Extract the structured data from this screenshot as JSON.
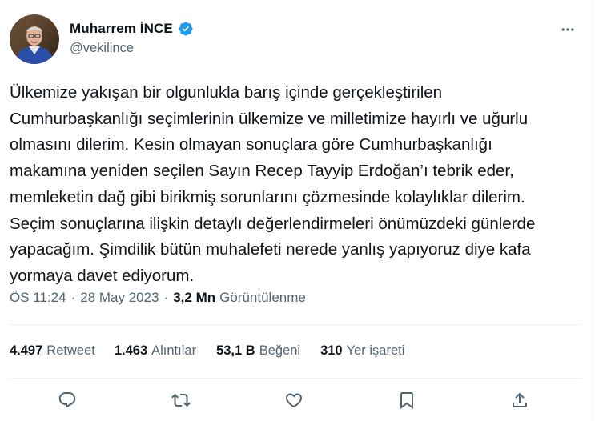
{
  "author": {
    "name": "Muharrem İNCE",
    "handle": "@vekilince",
    "verified": true
  },
  "tweet": {
    "lines": [
      "Ülkemize yakışan bir olgunlukla barış içinde gerçekleştirilen",
      "Cumhurbaşkanlığı seçimlerinin ülkemize ve milletimize hayırlı ve uğurlu",
      "olmasını dilerim. Kesin olmayan sonuçlara göre Cumhurbaşkanlığı",
      "makamına yeniden seçilen Sayın Recep Tayyip Erdoğan’ı tebrik eder,",
      "memleketin dağ gibi birikmiş sorunlarını çözmesinde kolaylıklar dilerim.",
      "Seçim sonuçlarına ilişkin detaylı değerlendirmeleri önümüzdeki günlerde",
      "yapacağım. Şimdilik bütün muhalefeti nerede yanlış yapıyoruz diye kafa",
      "yormaya davet ediyorum."
    ]
  },
  "meta": {
    "time": "ÖS 11:24",
    "separator": "·",
    "date": "28 May 2023",
    "views_count": "3,2 Mn",
    "views_label": "Görüntülenme"
  },
  "stats": {
    "retweets": {
      "count": "4.497",
      "label": "Retweet"
    },
    "quotes": {
      "count": "1.463",
      "label": "Alıntılar"
    },
    "likes": {
      "count": "53,1 B",
      "label": "Beğeni"
    },
    "bookmarks": {
      "count": "310",
      "label": "Yer işareti"
    }
  },
  "icons": {
    "more": "more-horizontal-icon",
    "verified": "verified-badge-icon",
    "reply": "reply-icon",
    "retweet": "retweet-icon",
    "like": "like-icon",
    "bookmark": "bookmark-icon",
    "share": "share-icon"
  },
  "colors": {
    "text": "#0f1419",
    "secondary": "#536471",
    "verified": "#1d9bf0",
    "divider": "#eff3f4"
  }
}
